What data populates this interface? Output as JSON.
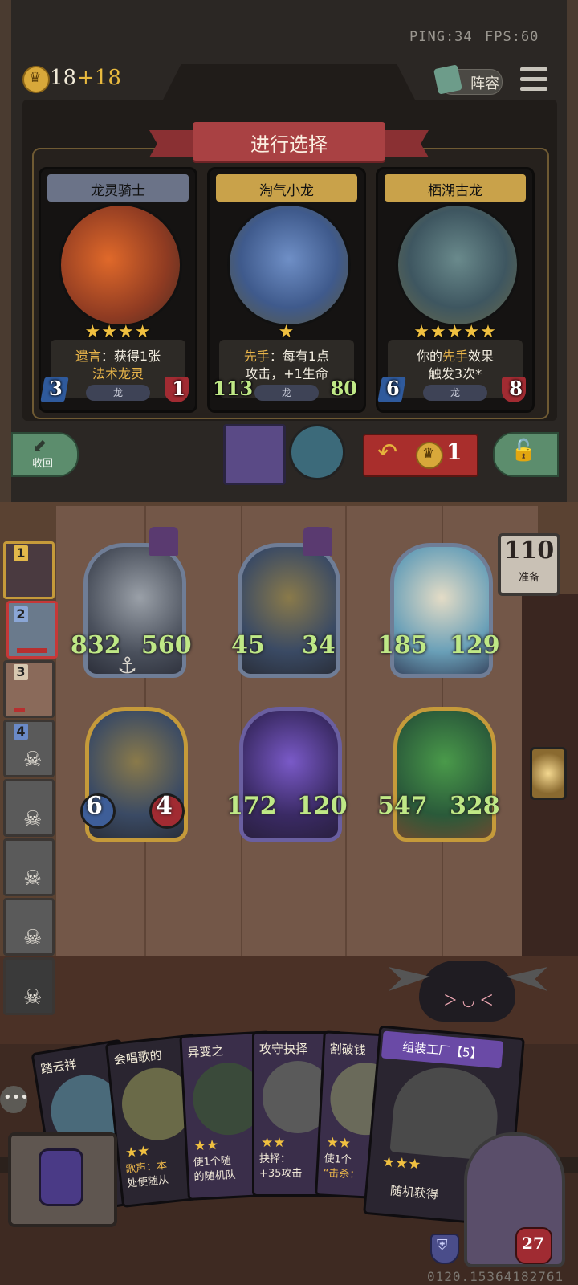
{
  "hud": {
    "ping": "PING:34",
    "fps": "FPS:60",
    "gold": "18",
    "gold_income": "+18",
    "lineup_label": "阵容"
  },
  "selection": {
    "banner": "进行选择",
    "cards": [
      {
        "name": "龙灵骑士",
        "stars": "★★★★",
        "desc_prefix": "遗言",
        "desc_line1": "：获得1张",
        "desc_line2": "法术龙灵",
        "tribe": "龙",
        "attack": "3",
        "health": "1"
      },
      {
        "name": "淘气小龙",
        "stars": "★",
        "desc_prefix": "先手",
        "desc_line1": "：每有1点",
        "desc_line2": "攻击，+1生命",
        "tribe": "龙",
        "attack": "113",
        "health": "80"
      },
      {
        "name": "栖湖古龙",
        "stars": "★★★★★",
        "desc_line1": "你的",
        "desc_highlight": "先手",
        "desc_line1b": "效果",
        "desc_line2": "触发3次*",
        "tribe": "龙",
        "attack": "6",
        "health": "8"
      }
    ],
    "return_label": "收回",
    "refresh_cost": "1"
  },
  "board": {
    "ready_count": "110",
    "ready_label": "准备",
    "units": [
      {
        "attack": "832",
        "health": "560"
      },
      {
        "attack": "45",
        "health": "34"
      },
      {
        "attack": "185",
        "health": "129"
      },
      {
        "attack": "6",
        "health": "4"
      },
      {
        "attack": "172",
        "health": "120"
      },
      {
        "attack": "547",
        "health": "328"
      }
    ]
  },
  "players": [
    {
      "rank": "1"
    },
    {
      "rank": "2"
    },
    {
      "rank": "3"
    },
    {
      "rank": "4"
    },
    {
      "rank": ""
    },
    {
      "rank": ""
    },
    {
      "rank": ""
    },
    {
      "rank": ""
    }
  ],
  "hand": {
    "cards": [
      {
        "title": "踏云祥",
        "desc": ""
      },
      {
        "title": "会唱歌的",
        "desc1": "歌声：本",
        "desc2": "处使随从"
      },
      {
        "title": "异变之",
        "desc1": "使1个随",
        "desc2": "的随机队"
      },
      {
        "title": "攻守抉择",
        "desc1": "抉择：",
        "desc2": "+35攻击"
      },
      {
        "title": "割破钱",
        "desc1": "使1个",
        "desc2": "“击杀："
      },
      {
        "title": "组装工厂【5】",
        "desc1": "随机获得"
      }
    ]
  },
  "player": {
    "hp": "27"
  },
  "session_id": "0120.15364182761"
}
